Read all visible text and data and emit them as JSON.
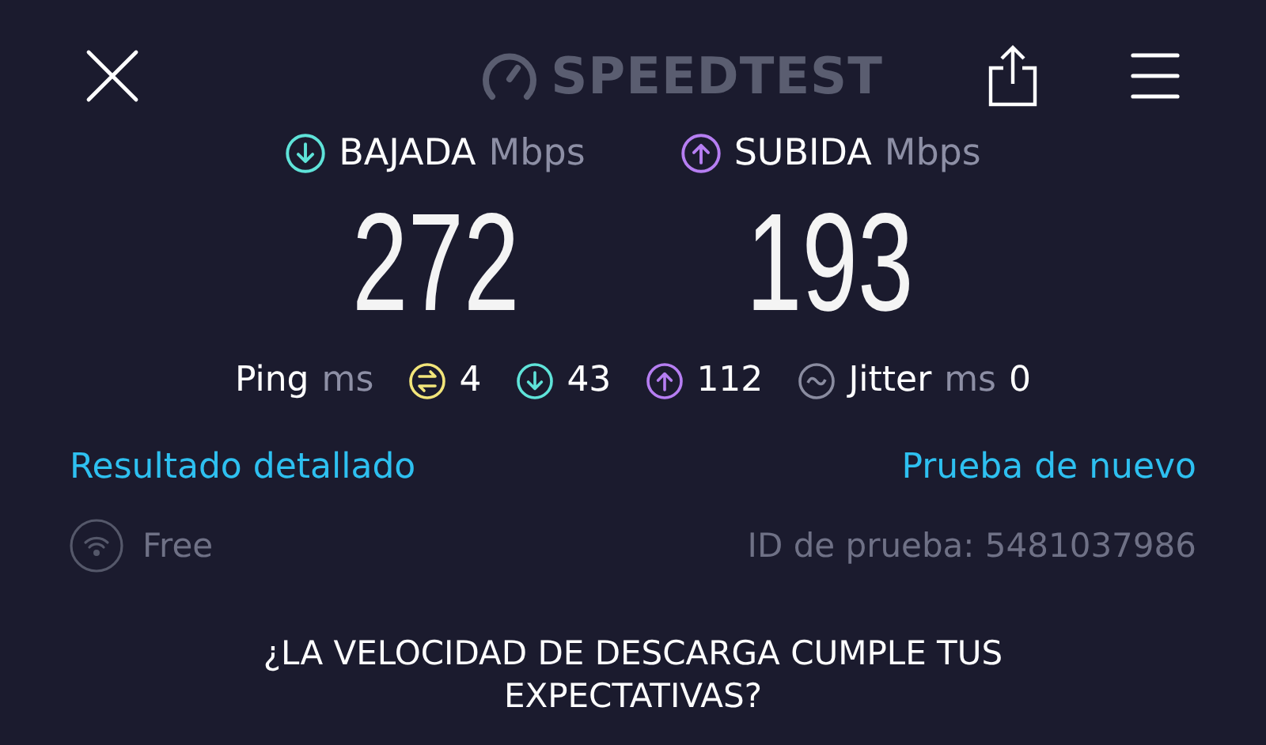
{
  "header": {
    "logo": "SPEEDTEST"
  },
  "results": [
    {
      "kind": "download",
      "label": "BAJADA",
      "unit": "Mbps",
      "value": "272",
      "color": "#5fe3d9"
    },
    {
      "kind": "upload",
      "label": "SUBIDA",
      "unit": "Mbps",
      "value": "193",
      "color": "#b67ef2"
    }
  ],
  "latency": {
    "label": "Ping",
    "unit": "ms",
    "items": [
      {
        "kind": "ping",
        "value": "4",
        "color": "#f2e57a"
      },
      {
        "kind": "download",
        "value": "43",
        "color": "#5fe3d9"
      },
      {
        "kind": "upload",
        "value": "112",
        "color": "#b67ef2"
      }
    ]
  },
  "jitter": {
    "label": "Jitter",
    "unit": "ms",
    "value": "0"
  },
  "links": [
    "Resultado detallado",
    "Prueba de nuevo"
  ],
  "network": {
    "name": "Free"
  },
  "test_id": "ID de prueba: 5481037986",
  "question": "¿LA VELOCIDAD DE DESCARGA CUMPLE TUS EXPECTATIVAS?"
}
